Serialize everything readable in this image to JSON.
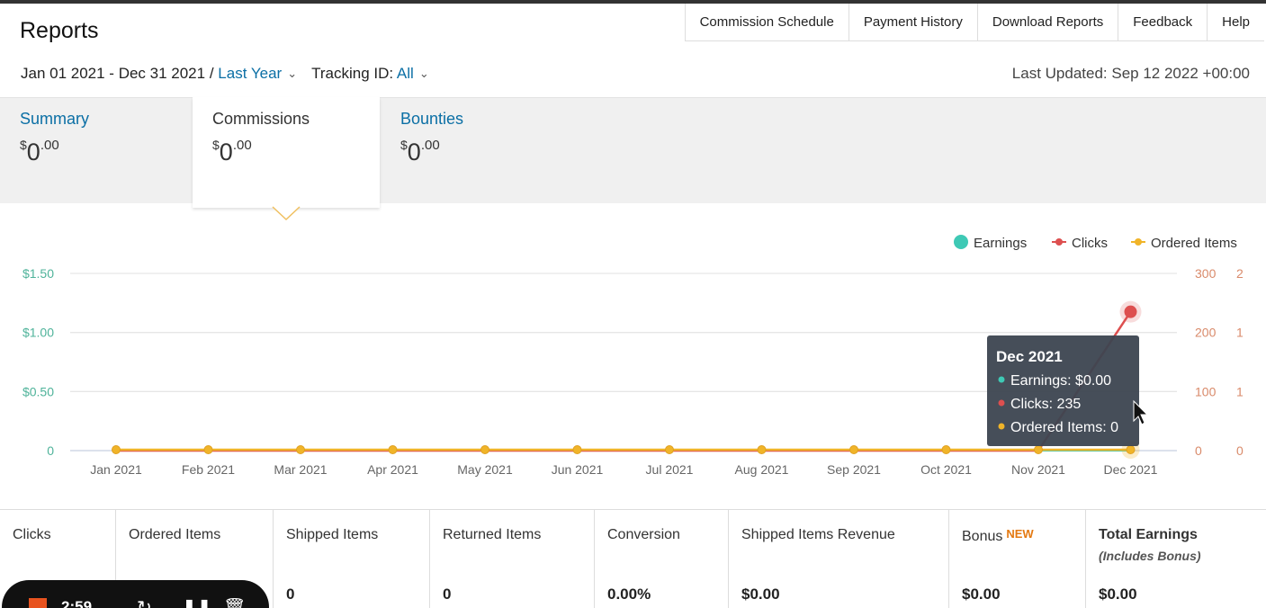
{
  "header": {
    "title": "Reports",
    "links": [
      "Commission Schedule",
      "Payment History",
      "Download Reports",
      "Feedback",
      "Help"
    ]
  },
  "filters": {
    "date_range": "Jan 01 2021 - Dec 31 2021 /",
    "period": "Last Year",
    "tracking_label": "Tracking ID:",
    "tracking_value": "All",
    "last_updated": "Last Updated: Sep 12 2022 +00:00"
  },
  "tabs": [
    {
      "label": "Summary",
      "currency": "$",
      "whole": "0",
      "cents": ".00"
    },
    {
      "label": "Commissions",
      "currency": "$",
      "whole": "0",
      "cents": ".00"
    },
    {
      "label": "Bounties",
      "currency": "$",
      "whole": "0",
      "cents": ".00"
    }
  ],
  "chart_data": {
    "type": "line",
    "x": [
      "Jan 2021",
      "Feb 2021",
      "Mar 2021",
      "Apr 2021",
      "May 2021",
      "Jun 2021",
      "Jul 2021",
      "Aug 2021",
      "Sep 2021",
      "Oct 2021",
      "Nov 2021",
      "Dec 2021"
    ],
    "series": [
      {
        "name": "Earnings",
        "axis": "left",
        "color": "#3ec9b5",
        "values": [
          0,
          0,
          0,
          0,
          0,
          0,
          0,
          0,
          0,
          0,
          0,
          0
        ]
      },
      {
        "name": "Clicks",
        "axis": "right1",
        "color": "#dd4f4f",
        "values": [
          0,
          0,
          0,
          0,
          0,
          0,
          0,
          0,
          0,
          0,
          0,
          235
        ]
      },
      {
        "name": "Ordered Items",
        "axis": "right2",
        "color": "#f0b429",
        "values": [
          0,
          0,
          0,
          0,
          0,
          0,
          0,
          0,
          0,
          0,
          0,
          0
        ]
      }
    ],
    "y_left": {
      "ticks": [
        "0",
        "$0.50",
        "$1.00",
        "$1.50"
      ],
      "range": [
        0,
        1.5
      ],
      "color": "#4fb39a"
    },
    "y_right1": {
      "ticks": [
        "0",
        "100",
        "200",
        "300"
      ],
      "range": [
        0,
        300
      ],
      "color": "#d98a6a"
    },
    "y_right2": {
      "ticks": [
        "0",
        "1",
        "1",
        "2"
      ],
      "color": "#d98a6a"
    },
    "legend_position": "top-right",
    "grid": true,
    "tooltip": {
      "title": "Dec 2021",
      "lines": [
        "Earnings: $0.00",
        "Clicks: 235",
        "Ordered Items: 0"
      ]
    }
  },
  "stats": [
    {
      "label": "Clicks",
      "value": ""
    },
    {
      "label": "Ordered Items",
      "value": ""
    },
    {
      "label": "Shipped Items",
      "value": "0"
    },
    {
      "label": "Returned Items",
      "value": "0"
    },
    {
      "label": "Conversion",
      "value": "0.00%"
    },
    {
      "label": "Shipped Items Revenue",
      "value": "$0.00"
    },
    {
      "label": "Bonus",
      "badge": "NEW",
      "value": "$0.00"
    },
    {
      "label": "Total Earnings",
      "sub": "(Includes Bonus)",
      "value": "$0.00"
    }
  ],
  "recorder": {
    "time": "2:59",
    "color": "#e8531f"
  }
}
